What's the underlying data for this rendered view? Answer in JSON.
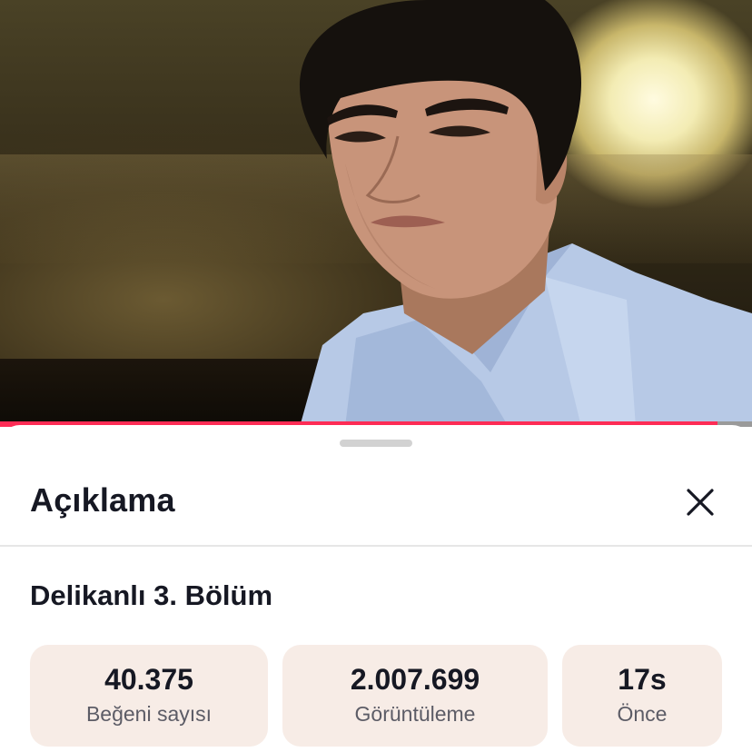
{
  "video": {
    "progress": 0.954,
    "accent_color": "#fe2c55"
  },
  "sheet": {
    "title": "Açıklama",
    "close_icon": "close-icon"
  },
  "description": {
    "title": "Delikanlı 3. Bölüm"
  },
  "stats": [
    {
      "value": "40.375",
      "label": "Beğeni sayısı"
    },
    {
      "value": "2.007.699",
      "label": "Görüntüleme"
    },
    {
      "value": "17s",
      "label": "Önce"
    }
  ],
  "colors": {
    "stat_background": "#f7ece6",
    "text_primary": "#161823",
    "text_secondary": "#5c5c66"
  }
}
